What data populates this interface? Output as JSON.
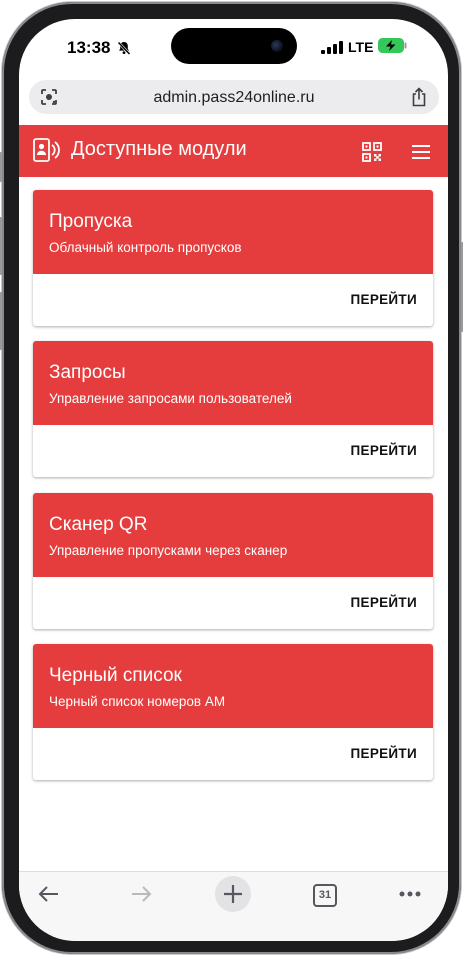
{
  "status": {
    "time": "13:38",
    "network": "LTE",
    "battery_color": "#34c759"
  },
  "browser": {
    "url": "admin.pass24online.ru",
    "tabs_count": "31",
    "icons": [
      "lens-icon",
      "share-icon",
      "back-arrow-icon",
      "forward-arrow-icon",
      "new-tab-plus-icon",
      "tabs-icon",
      "more-icon"
    ]
  },
  "header": {
    "title": "Доступные модули",
    "accent_color": "#e53d3d"
  },
  "modules": [
    {
      "title": "Пропуска",
      "subtitle": "Облачный контроль пропусков",
      "action": "ПЕРЕЙТИ"
    },
    {
      "title": "Запросы",
      "subtitle": "Управление запросами пользователей",
      "action": "ПЕРЕЙТИ"
    },
    {
      "title": "Сканер QR",
      "subtitle": "Управление пропусками через сканер",
      "action": "ПЕРЕЙТИ"
    },
    {
      "title": "Черный список",
      "subtitle": "Черный список номеров АМ",
      "action": "ПЕРЕЙТИ"
    }
  ]
}
